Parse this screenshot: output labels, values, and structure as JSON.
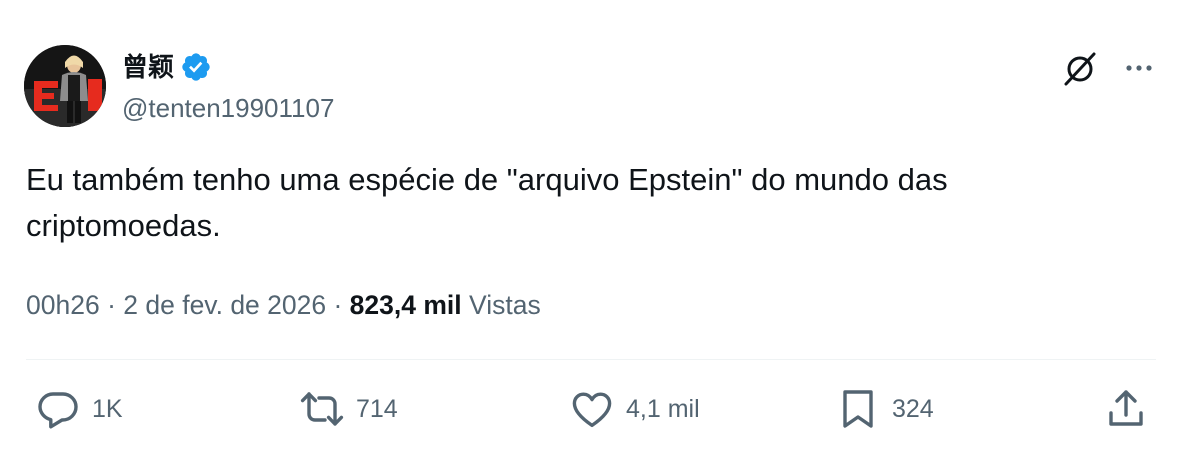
{
  "author": {
    "display_name": "曾颖",
    "handle": "@tenten19901107",
    "verified": true,
    "verified_color": "#1d9bf0"
  },
  "tweet": {
    "text": "Eu também tenho uma espécie de \"arquivo Epstein\" do mundo das criptomoedas."
  },
  "meta": {
    "time": "00h26",
    "separator1": " · ",
    "date": "2 de fev. de 2026",
    "separator2": " · ",
    "views_count": "823,4 mil",
    "views_label": " Vistas"
  },
  "actions": {
    "reply_count": "1K",
    "repost_count": "714",
    "like_count": "4,1 mil",
    "bookmark_count": "324"
  },
  "icons": {
    "grok": "grok-icon",
    "more": "more-icon",
    "reply": "reply-icon",
    "repost": "repost-icon",
    "like": "heart-icon",
    "bookmark": "bookmark-icon",
    "share": "share-icon"
  },
  "colors": {
    "text_primary": "#0f1419",
    "text_secondary": "#536471",
    "divider": "#eff3f4"
  }
}
